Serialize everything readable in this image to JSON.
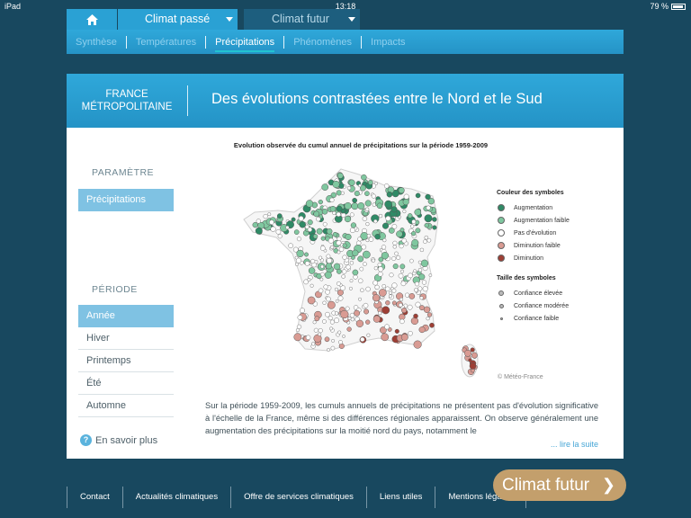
{
  "status": {
    "device": "iPad",
    "time": "13:18",
    "battery": "79 %"
  },
  "topnav": {
    "home_icon": "home-icon",
    "tab_past": "Climat passé",
    "tab_future": "Climat futur"
  },
  "subnav": [
    "Synthèse",
    "Températures",
    "Précipitations",
    "Phénomènes",
    "Impacts"
  ],
  "header": {
    "region_line1": "FRANCE",
    "region_line2": "MÉTROPOLITAINE",
    "title": "Des évolutions contrastées entre le Nord et le Sud"
  },
  "sidebar": {
    "param_label": "PARAMÈTRE",
    "param_value": "Précipitations",
    "period_label": "PÉRIODE",
    "periods": [
      "Année",
      "Hiver",
      "Printemps",
      "Été",
      "Automne"
    ],
    "more": "En savoir plus"
  },
  "figure": {
    "title": "Evolution observée du cumul annuel de précipitations sur la période 1959-2009",
    "legend_color_title": "Couleur des symboles",
    "legend_colors": [
      {
        "label": "Augmentation",
        "color": "#2f8a66"
      },
      {
        "label": "Augmentation faible",
        "color": "#7fc79f"
      },
      {
        "label": "Pas d'évolution",
        "color": "#ffffff"
      },
      {
        "label": "Diminution faible",
        "color": "#d99b93"
      },
      {
        "label": "Diminution",
        "color": "#9e3f35"
      }
    ],
    "legend_size_title": "Taille des symboles",
    "legend_sizes": [
      "Confiance élevée",
      "Confiance modérée",
      "Confiance faible"
    ],
    "copyright": "© Météo-France"
  },
  "body": {
    "text": "Sur la période 1959-2009, les cumuls annuels de précipitations ne présentent pas d'évolution significative à l'échelle de la France, même si des différences régionales apparaissent. On observe généralement une augmentation des précipitations sur la moitié nord du pays, notamment le",
    "read_more": "... lire la suite"
  },
  "footer": [
    "Contact",
    "Actualités climatiques",
    "Offre de services climatiques",
    "Liens utiles",
    "Mentions légales"
  ],
  "cta": {
    "label": "Climat futur"
  }
}
